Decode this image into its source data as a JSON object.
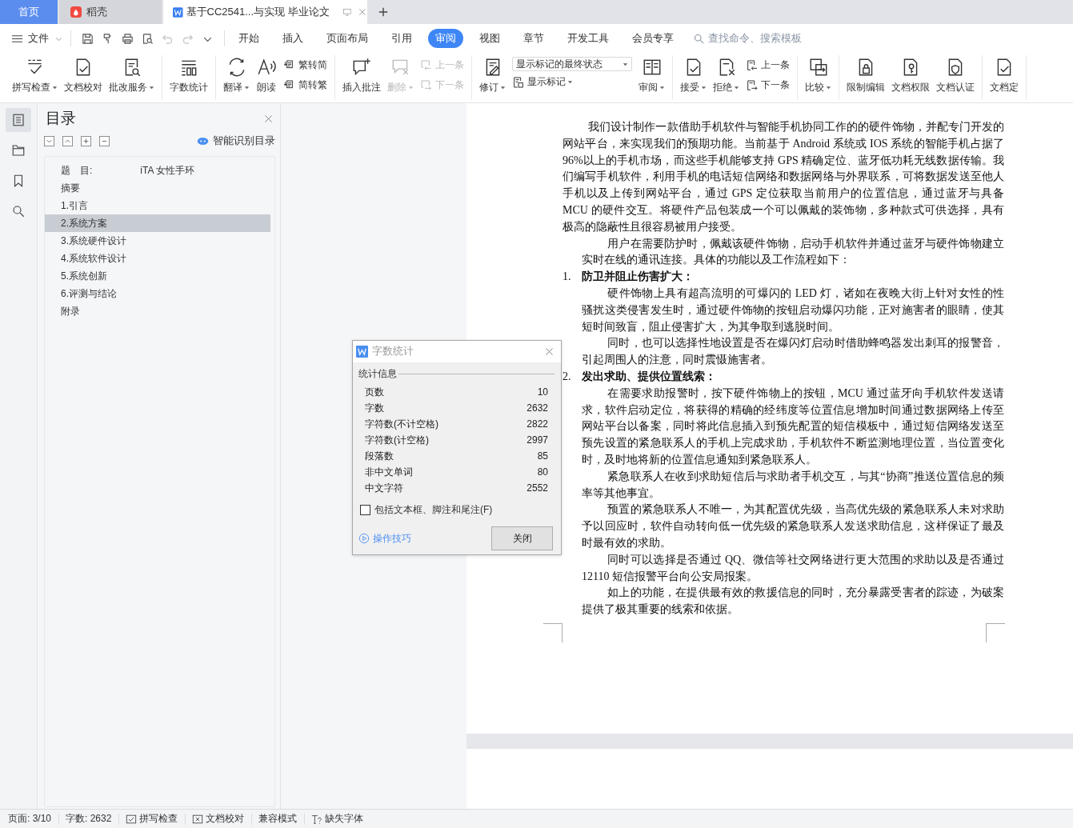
{
  "tabs": [
    {
      "kind": "home",
      "label": "首页",
      "selected": false
    },
    {
      "kind": "app",
      "label": "稻壳",
      "selected": false
    },
    {
      "kind": "document",
      "label": "基于CC2541...与实现 毕业论文",
      "selected": true
    }
  ],
  "menu": {
    "file": "文件",
    "quick_tools": [
      {
        "disabled": false
      },
      {
        "disabled": false
      },
      {
        "disabled": false
      },
      {
        "disabled": false
      },
      {
        "disabled": true
      },
      {
        "disabled": true
      },
      {
        "disabled": false
      }
    ],
    "tabs": [
      {
        "label": "开始",
        "selected": false
      },
      {
        "label": "插入",
        "selected": false
      },
      {
        "label": "页面布局",
        "selected": false
      },
      {
        "label": "引用",
        "selected": false
      },
      {
        "label": "审阅",
        "selected": true
      },
      {
        "label": "视图",
        "selected": false
      },
      {
        "label": "章节",
        "selected": false
      },
      {
        "label": "开发工具",
        "selected": false
      },
      {
        "label": "会员专享",
        "selected": false
      }
    ],
    "search": {
      "placeholder": "查找命令、搜索模板"
    }
  },
  "ribbon": [
    {
      "items": [
        {
          "kind": "large",
          "label": "拼写检查",
          "dropdown": true,
          "disabled": false
        },
        {
          "kind": "large",
          "label": "文档校对",
          "dropdown": false,
          "disabled": false
        },
        {
          "kind": "large",
          "label": "批改服务",
          "dropdown": true,
          "disabled": false
        }
      ]
    },
    {
      "items": [
        {
          "kind": "large",
          "label": "字数统计",
          "dropdown": false,
          "disabled": false
        }
      ]
    },
    {
      "items": [
        {
          "kind": "large",
          "label": "翻译",
          "dropdown": true,
          "disabled": false
        },
        {
          "kind": "large",
          "label": "朗读",
          "dropdown": false,
          "disabled": false
        },
        {
          "kind": "pair",
          "rows": [
            {
              "label": "繁转简",
              "disabled": false
            },
            {
              "label": "简转繁",
              "disabled": false
            }
          ]
        }
      ]
    },
    {
      "items": [
        {
          "kind": "large",
          "label": "插入批注",
          "dropdown": false,
          "disabled": false
        },
        {
          "kind": "large",
          "label": "删除",
          "dropdown": true,
          "disabled": true
        },
        {
          "kind": "pair",
          "rows": [
            {
              "label": "上一条",
              "disabled": true
            },
            {
              "label": "下一条",
              "disabled": true
            }
          ]
        }
      ]
    },
    {
      "items": [
        {
          "kind": "large",
          "label": "修订",
          "dropdown": true,
          "disabled": false
        },
        {
          "kind": "select",
          "value": "显示标记的最终状态",
          "below": {
            "label": "显示标记",
            "dropdown": true
          }
        },
        {
          "kind": "large",
          "label": "审阅",
          "dropdown": true,
          "disabled": false
        }
      ]
    },
    {
      "items": [
        {
          "kind": "large",
          "label": "接受",
          "dropdown": true,
          "disabled": false
        },
        {
          "kind": "large",
          "label": "拒绝",
          "dropdown": true,
          "disabled": false
        },
        {
          "kind": "pair",
          "rows": [
            {
              "label": "上一条",
              "disabled": false
            },
            {
              "label": "下一条",
              "disabled": false
            }
          ]
        }
      ]
    },
    {
      "items": [
        {
          "kind": "large",
          "label": "比较",
          "dropdown": true,
          "disabled": false
        }
      ]
    },
    {
      "items": [
        {
          "kind": "large",
          "label": "限制编辑",
          "dropdown": false,
          "disabled": false
        },
        {
          "kind": "large",
          "label": "文档权限",
          "dropdown": false,
          "disabled": false
        },
        {
          "kind": "large",
          "label": "文档认证",
          "dropdown": false,
          "disabled": false
        }
      ]
    },
    {
      "items": [
        {
          "kind": "large",
          "label": "文档定",
          "dropdown": false,
          "disabled": false
        }
      ]
    }
  ],
  "sidebar_rail": [
    {
      "selected": true
    },
    {
      "selected": false
    },
    {
      "selected": false
    },
    {
      "selected": false
    }
  ],
  "toc_panel": {
    "title": "目录",
    "smart_button": "智能识别目录",
    "items": [
      {
        "label": "题　目:　　　　　iTA 女性手环",
        "selected": false
      },
      {
        "label": "摘要",
        "selected": false
      },
      {
        "label": "1.引言",
        "selected": false
      },
      {
        "label": "2.系统方案",
        "selected": true
      },
      {
        "label": "3.系统硬件设计",
        "selected": false
      },
      {
        "label": "4.系统软件设计",
        "selected": false
      },
      {
        "label": "5.系统创新",
        "selected": false
      },
      {
        "label": "6.评测与结论",
        "selected": false
      },
      {
        "label": "附录",
        "selected": false
      }
    ]
  },
  "document": {
    "paragraphs": [
      {
        "kind": "lead",
        "text": "我们设计制作一款借助手机软件与智能手机协同工作的的硬件饰物，并配专门开发的网站平台，来实现我们的预期功能。当前基于 Android 系统或 IOS 系统的智能手机占据了 96%以上的手机市场，而这些手机能够支持 GPS 精确定位、蓝牙低功耗无线数据传输。我们编写手机软件，利用手机的电话短信网络和数据网络与外界联系，可将数据发送至他人手机以及上传到网站平台，通过 GPS 定位获取当前用户的位置信息，通过蓝牙与具备 MCU 的硬件交互。将硬件产品包装成一个可以佩戴的装饰物，多种款式可供选择，具有极高的隐蔽性且很容易被用户接受。"
      },
      {
        "kind": "text",
        "text": "用户在需要防护时，佩戴该硬件饰物，启动手机软件并通过蓝牙与硬件饰物建立实时在线的通讯连接。具体的功能以及工作流程如下："
      },
      {
        "kind": "heading",
        "number": "1.",
        "text": "防卫并阻止伤害扩大："
      },
      {
        "kind": "text",
        "text": "硬件饰物上具有超高流明的可爆闪的 LED 灯，诸如在夜晚大街上针对女性的性骚扰这类侵害发生时，通过硬件饰物的按钮启动爆闪功能，正对施害者的眼睛，使其短时间致盲，阻止侵害扩大，为其争取到逃脱时间。"
      },
      {
        "kind": "text",
        "text": "同时，也可以选择性地设置是否在爆闪灯启动时借助蜂鸣器发出刺耳的报警音，引起周围人的注意，同时震慑施害者。"
      },
      {
        "kind": "heading",
        "number": "2.",
        "text": "发出求助、提供位置线索："
      },
      {
        "kind": "text",
        "text": "在需要求助报警时，按下硬件饰物上的按钮，MCU 通过蓝牙向手机软件发送请求，软件启动定位，将获得的精确的经纬度等位置信息增加时间通过数据网络上传至网站平台以备案，同时将此信息插入到预先配置的短信模板中，通过短信网络发送至预先设置的紧急联系人的手机上完成求助，手机软件不断监测地理位置，当位置变化时，及时地将新的位置信息通知到紧急联系人。"
      },
      {
        "kind": "text",
        "text": "紧急联系人在收到求助短信后与求助者手机交互，与其“协商”推送位置信息的频率等其他事宜。"
      },
      {
        "kind": "text",
        "text": "预置的紧急联系人不唯一，为其配置优先级，当高优先级的紧急联系人未对求助予以回应时，软件自动转向低一优先级的紧急联系人发送求助信息，这样保证了最及时最有效的求助。"
      },
      {
        "kind": "text",
        "text": "同时可以选择是否通过 QQ、微信等社交网络进行更大范围的求助以及是否通过 12110 短信报警平台向公安局报案。"
      },
      {
        "kind": "text",
        "text": "如上的功能，在提供最有效的救援信息的同时，充分暴露受害者的踪迹，为破案提供了极其重要的线索和依据。"
      }
    ]
  },
  "dialog": {
    "title": "字数统计",
    "section": "统计信息",
    "rows": [
      {
        "label": "页数",
        "value": "10"
      },
      {
        "label": "字数",
        "value": "2632"
      },
      {
        "label": "字符数(不计空格)",
        "value": "2822"
      },
      {
        "label": "字符数(计空格)",
        "value": "2997"
      },
      {
        "label": "段落数",
        "value": "85"
      },
      {
        "label": "非中文单词",
        "value": "80"
      },
      {
        "label": "中文字符",
        "value": "2552"
      }
    ],
    "option": {
      "label": "包括文本框、脚注和尾注(F)",
      "checked": false
    },
    "tips_link": "操作技巧",
    "close_button": "关闭"
  },
  "status_bar": [
    {
      "kind": "text",
      "label": "页面: 3/10"
    },
    {
      "kind": "text",
      "label": "字数: 2632"
    },
    {
      "kind": "spell",
      "label": "拼写检查"
    },
    {
      "kind": "proof",
      "label": "文档校对"
    },
    {
      "kind": "text",
      "label": "兼容模式"
    },
    {
      "kind": "font",
      "label": "缺失字体"
    }
  ]
}
